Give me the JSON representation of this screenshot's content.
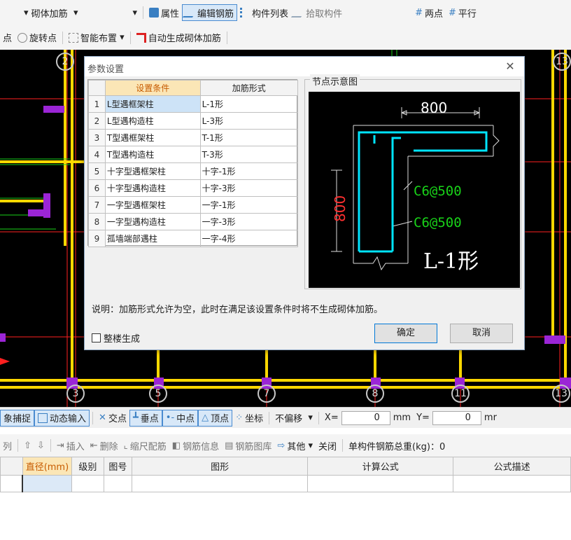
{
  "toolbar1": {
    "dropdown_label": "砌体加筋",
    "attr": "属性",
    "edit_rebar": "编辑钢筋",
    "comp_list": "构件列表",
    "pick_comp": "拾取构件",
    "two_points": "两点",
    "parallel": "平行"
  },
  "toolbar2": {
    "point": "点",
    "rotate_point": "旋转点",
    "smart_layout": "智能布置",
    "auto_gen": "自动生成砌体加筋"
  },
  "cad": {
    "axis_top": [
      "2",
      "13"
    ],
    "axis_bottom": [
      "3",
      "5",
      "7",
      "8",
      "11",
      "13"
    ]
  },
  "dialog": {
    "title": "参数设置",
    "col_cond": "设置条件",
    "col_form": "加筋形式",
    "rows": [
      {
        "no": "1",
        "cond": "L型遇框架柱",
        "form": "L-1形"
      },
      {
        "no": "2",
        "cond": "L型遇构造柱",
        "form": "L-3形"
      },
      {
        "no": "3",
        "cond": "T型遇框架柱",
        "form": "T-1形"
      },
      {
        "no": "4",
        "cond": "T型遇构造柱",
        "form": "T-3形"
      },
      {
        "no": "5",
        "cond": "十字型遇框架柱",
        "form": "十字-1形"
      },
      {
        "no": "6",
        "cond": "十字型遇构造柱",
        "form": "十字-3形"
      },
      {
        "no": "7",
        "cond": "一字型遇框架柱",
        "form": "一字-1形"
      },
      {
        "no": "8",
        "cond": "一字型遇构造柱",
        "form": "一字-3形"
      },
      {
        "no": "9",
        "cond": "孤墙端部遇柱",
        "form": "一字-4形"
      }
    ],
    "preview_label": "节点示意图",
    "preview": {
      "dim_h": "800",
      "dim_v": "800",
      "rebar1": "C6@500",
      "rebar2": "C6@500",
      "shape": "L-1形"
    },
    "note": "说明：加筋形式允许为空，此时在满足该设置条件时将不生成砌体加筋。",
    "whole_floor": "整楼生成",
    "ok": "确定",
    "cancel": "取消"
  },
  "snapbar": {
    "snap": "象捕捉",
    "dyn_input": "动态输入",
    "intersect": "交点",
    "perp": "垂点",
    "mid": "中点",
    "vertex": "顶点",
    "coord": "坐标",
    "no_offset": "不偏移",
    "x_label": "X=",
    "x_val": "0",
    "unit": "mm",
    "y_label": "Y=",
    "y_val": "0",
    "unit2": "mr"
  },
  "rebarbar": {
    "col": "列",
    "insert": "插入",
    "delete": "删除",
    "scale": "缩尺配筋",
    "info": "钢筋信息",
    "lib": "钢筋图库",
    "other": "其他",
    "close": "关闭",
    "weight": "单构件钢筋总重(kg)：0"
  },
  "btable": {
    "headers": [
      "直径(mm)",
      "级别",
      "图号",
      "图形",
      "计算公式",
      "公式描述"
    ]
  }
}
